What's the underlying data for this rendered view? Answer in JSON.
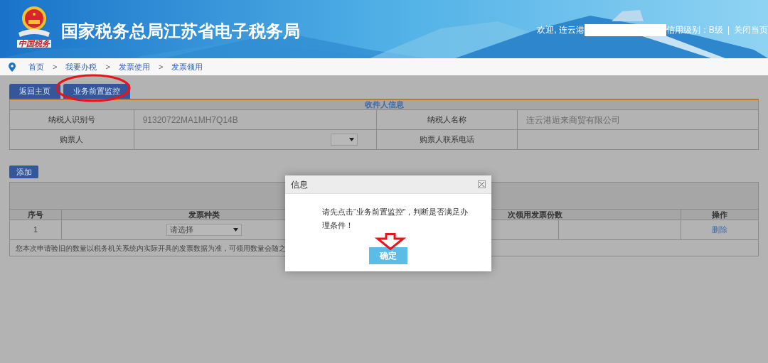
{
  "header": {
    "seal_text": "中国税务",
    "title": "国家税务总局江苏省电子税务局",
    "welcome": "欢迎, 连云港",
    "credit": "信用级别：B级",
    "separator": "|",
    "close": "关闭当页"
  },
  "breadcrumb": [
    "首页",
    "我要办税",
    "发票使用",
    "发票领用"
  ],
  "breadcrumb_separator": ">",
  "toolbar": [
    {
      "label": "返回主页",
      "highlighted": false
    },
    {
      "label": "业务前置监控",
      "highlighted": true
    }
  ],
  "recipient": {
    "title": "收件人信息",
    "rows": [
      {
        "cells": [
          {
            "kind": "label",
            "text": "纳税人识别号"
          },
          {
            "kind": "value",
            "text": "91320722MA1MH7Q14B"
          },
          {
            "kind": "label",
            "text": "纳税人名称"
          },
          {
            "kind": "value",
            "text": "连云港逅来商贸有限公司"
          }
        ]
      },
      {
        "cells": [
          {
            "kind": "label",
            "text": "购票人"
          },
          {
            "kind": "select"
          },
          {
            "kind": "label",
            "text": "购票人联系电话"
          },
          {
            "kind": "value"
          }
        ]
      }
    ]
  },
  "add_button": "添加",
  "invoice_table": {
    "columns": [
      "序号",
      "发票种类",
      "次领用发票份数",
      "操作"
    ],
    "rows": [
      {
        "index": "1",
        "type_placeholder": "请选择",
        "action": "删除"
      }
    ],
    "note": "您本次申请验旧的数量以税务机关系统内实际开具的发票数据为准，可领用数量会随之"
  },
  "dialog": {
    "title": "信息",
    "message": "请先点击“业务前置监控”，判断是否满足办理条件！",
    "confirm": "确定"
  }
}
